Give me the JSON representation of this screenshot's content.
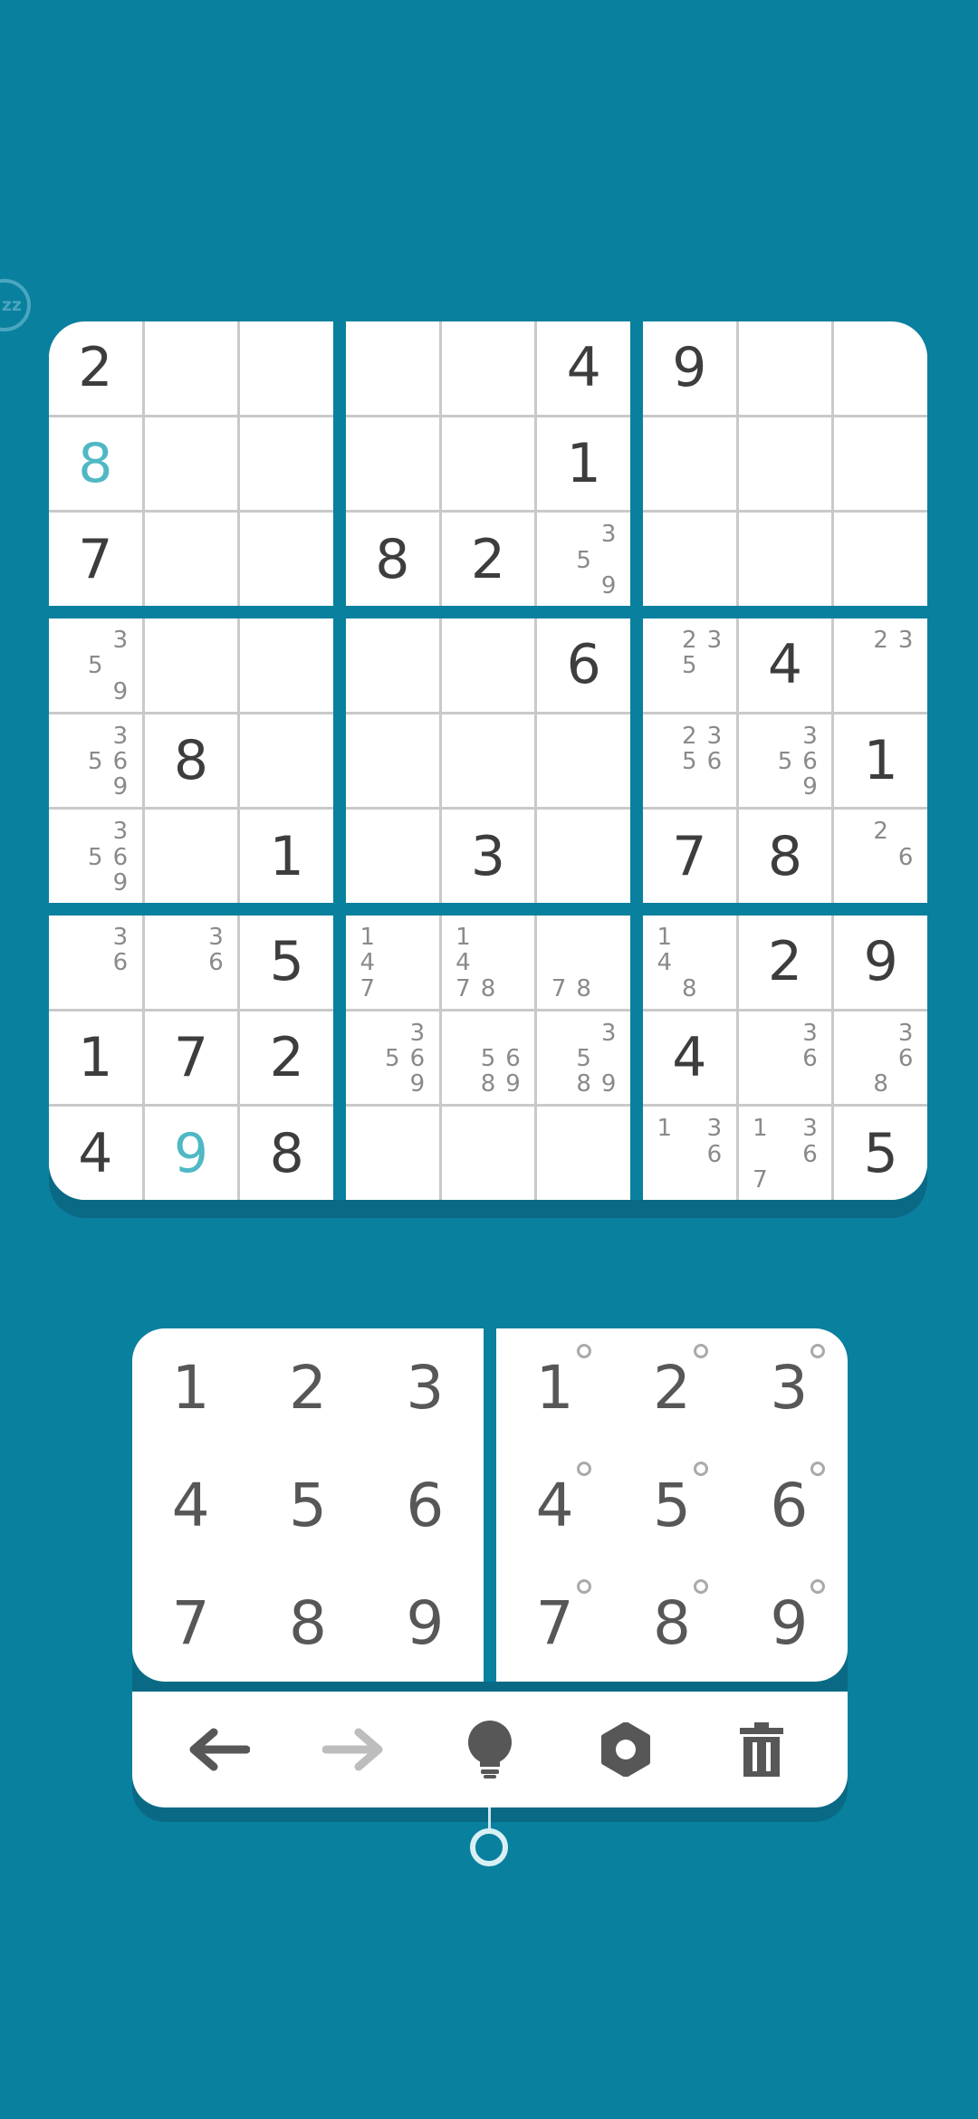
{
  "app": {
    "sleep_label": "zz"
  },
  "colors": {
    "background": "#0a809f",
    "given": "#3d3d3d",
    "user_entry": "#4fb8c4",
    "note": "#8a8a8a"
  },
  "board": {
    "cells": [
      [
        "2",
        "",
        "",
        "",
        "",
        "4",
        "9",
        "",
        ""
      ],
      [
        "8",
        "",
        "",
        "",
        "",
        "1",
        "",
        "",
        ""
      ],
      [
        "7",
        "",
        "",
        "8",
        "2",
        "",
        "",
        "",
        ""
      ],
      [
        "",
        "",
        "",
        "",
        "",
        "6",
        "",
        "4",
        ""
      ],
      [
        "",
        "8",
        "",
        "",
        "",
        "",
        "",
        "",
        "1"
      ],
      [
        "",
        "",
        "1",
        "",
        "3",
        "",
        "7",
        "8",
        ""
      ],
      [
        "",
        "",
        "5",
        "",
        "",
        "",
        "",
        "2",
        "9"
      ],
      [
        "1",
        "7",
        "2",
        "",
        "",
        "",
        "4",
        "",
        ""
      ],
      [
        "4",
        "9",
        "8",
        "",
        "",
        "",
        "",
        "",
        "5"
      ]
    ],
    "user_entries": [
      [
        1,
        0
      ],
      [
        8,
        1
      ]
    ],
    "notes": {
      "2,5": [
        3,
        5,
        9
      ],
      "3,0": [
        3,
        5,
        9
      ],
      "3,6": [
        2,
        3,
        5
      ],
      "3,8": [
        2,
        3
      ],
      "4,0": [
        3,
        5,
        6,
        9
      ],
      "4,6": [
        2,
        3,
        5,
        6
      ],
      "4,7": [
        3,
        5,
        6,
        9
      ],
      "5,0": [
        3,
        5,
        6,
        9
      ],
      "5,8": [
        2,
        6
      ],
      "6,0": [
        3,
        6
      ],
      "6,1": [
        3,
        6
      ],
      "6,3": [
        1,
        4,
        7
      ],
      "6,4": [
        1,
        4,
        7,
        8
      ],
      "6,5": [
        7,
        8
      ],
      "6,6": [
        1,
        4,
        8
      ],
      "7,3": [
        3,
        5,
        6,
        9
      ],
      "7,4": [
        5,
        6,
        8,
        9
      ],
      "7,5": [
        3,
        5,
        8,
        9
      ],
      "7,7": [
        3,
        6
      ],
      "7,8": [
        3,
        6,
        8
      ],
      "8,6": [
        1,
        3,
        6
      ],
      "8,7": [
        1,
        3,
        6,
        7
      ]
    }
  },
  "number_pad": {
    "values": [
      "1",
      "2",
      "3",
      "4",
      "5",
      "6",
      "7",
      "8",
      "9"
    ],
    "notes": [
      "1",
      "2",
      "3",
      "4",
      "5",
      "6",
      "7",
      "8",
      "9"
    ]
  },
  "toolbar": {
    "undo_icon": "arrow-left-icon",
    "redo_icon": "arrow-right-icon",
    "hint_icon": "lightbulb-icon",
    "settings_icon": "gear-icon",
    "erase_icon": "trash-icon",
    "redo_enabled": false
  }
}
